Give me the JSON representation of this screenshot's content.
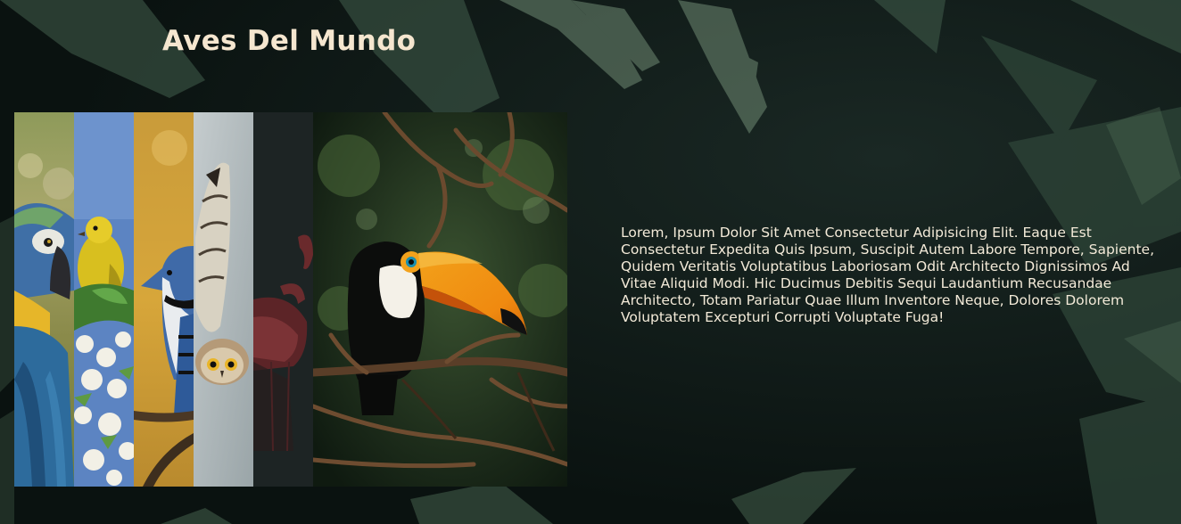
{
  "page": {
    "title": "Aves Del Mundo",
    "description": "Lorem, Ipsum Dolor Sit Amet Consectetur Adipisicing Elit. Eaque Est Consectetur Expedita Quis Ipsum, Suscipit Autem Labore Tempore, Sapiente, Quidem Veritatis Voluptatibus Laboriosam Odit Architecto Dignissimos Ad Vitae Aliquid Modi. Hic Ducimus Debitis Sequi Laudantium Recusandae Architecto, Totam Pariatur Quae Illum Inventore Neque, Dolores Dolorem Voluptatem Excepturi Corrupti Voluptate Fuga!"
  },
  "colors": {
    "background": "#0b1412",
    "title_text": "#f5e6cf",
    "body_text": "#f3ead8"
  },
  "gallery": {
    "panels": [
      {
        "subject": "macaw",
        "icon": "macaw-image",
        "active": false
      },
      {
        "subject": "yellow-warbler",
        "icon": "yellow-bird-image",
        "active": false
      },
      {
        "subject": "blue-jay",
        "icon": "blue-jay-image",
        "active": false
      },
      {
        "subject": "owl",
        "icon": "owl-image",
        "active": false
      },
      {
        "subject": "flamingo",
        "icon": "flamingo-image",
        "active": false
      },
      {
        "subject": "toucan",
        "icon": "toucan-image",
        "active": true
      }
    ]
  }
}
